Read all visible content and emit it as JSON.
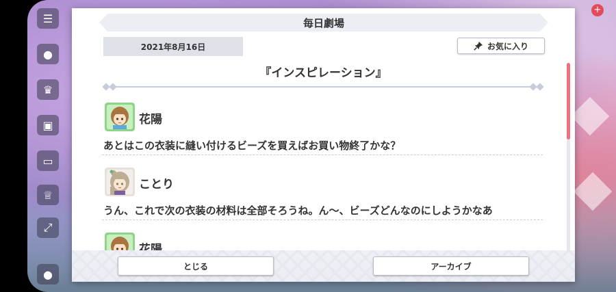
{
  "dialog": {
    "title": "毎日劇場",
    "date": "2021年8月16日",
    "favorite_label": "お気に入り",
    "episode_title": "『インスピレーション』"
  },
  "entries": [
    {
      "speaker": "花陽",
      "text": "あとはこの衣装に縫い付けるビーズを買えばお買い物終了かな？",
      "avatar": "hanayo-avatar"
    },
    {
      "speaker": "ことり",
      "text": "うん、これで次の衣装の材料は全部そろうね。ん〜、ビーズどんなのにしようかなあ",
      "avatar": "kotori-avatar"
    },
    {
      "speaker": "花陽",
      "text": "",
      "avatar": "hanayo-avatar"
    }
  ],
  "footer": {
    "close_label": "とじる",
    "archive_label": "アーカイブ"
  },
  "colors": {
    "accent_scroll": "#f07080",
    "hanayo_frame": "#8ed48a",
    "kotori_frame": "#e8e0dc"
  }
}
